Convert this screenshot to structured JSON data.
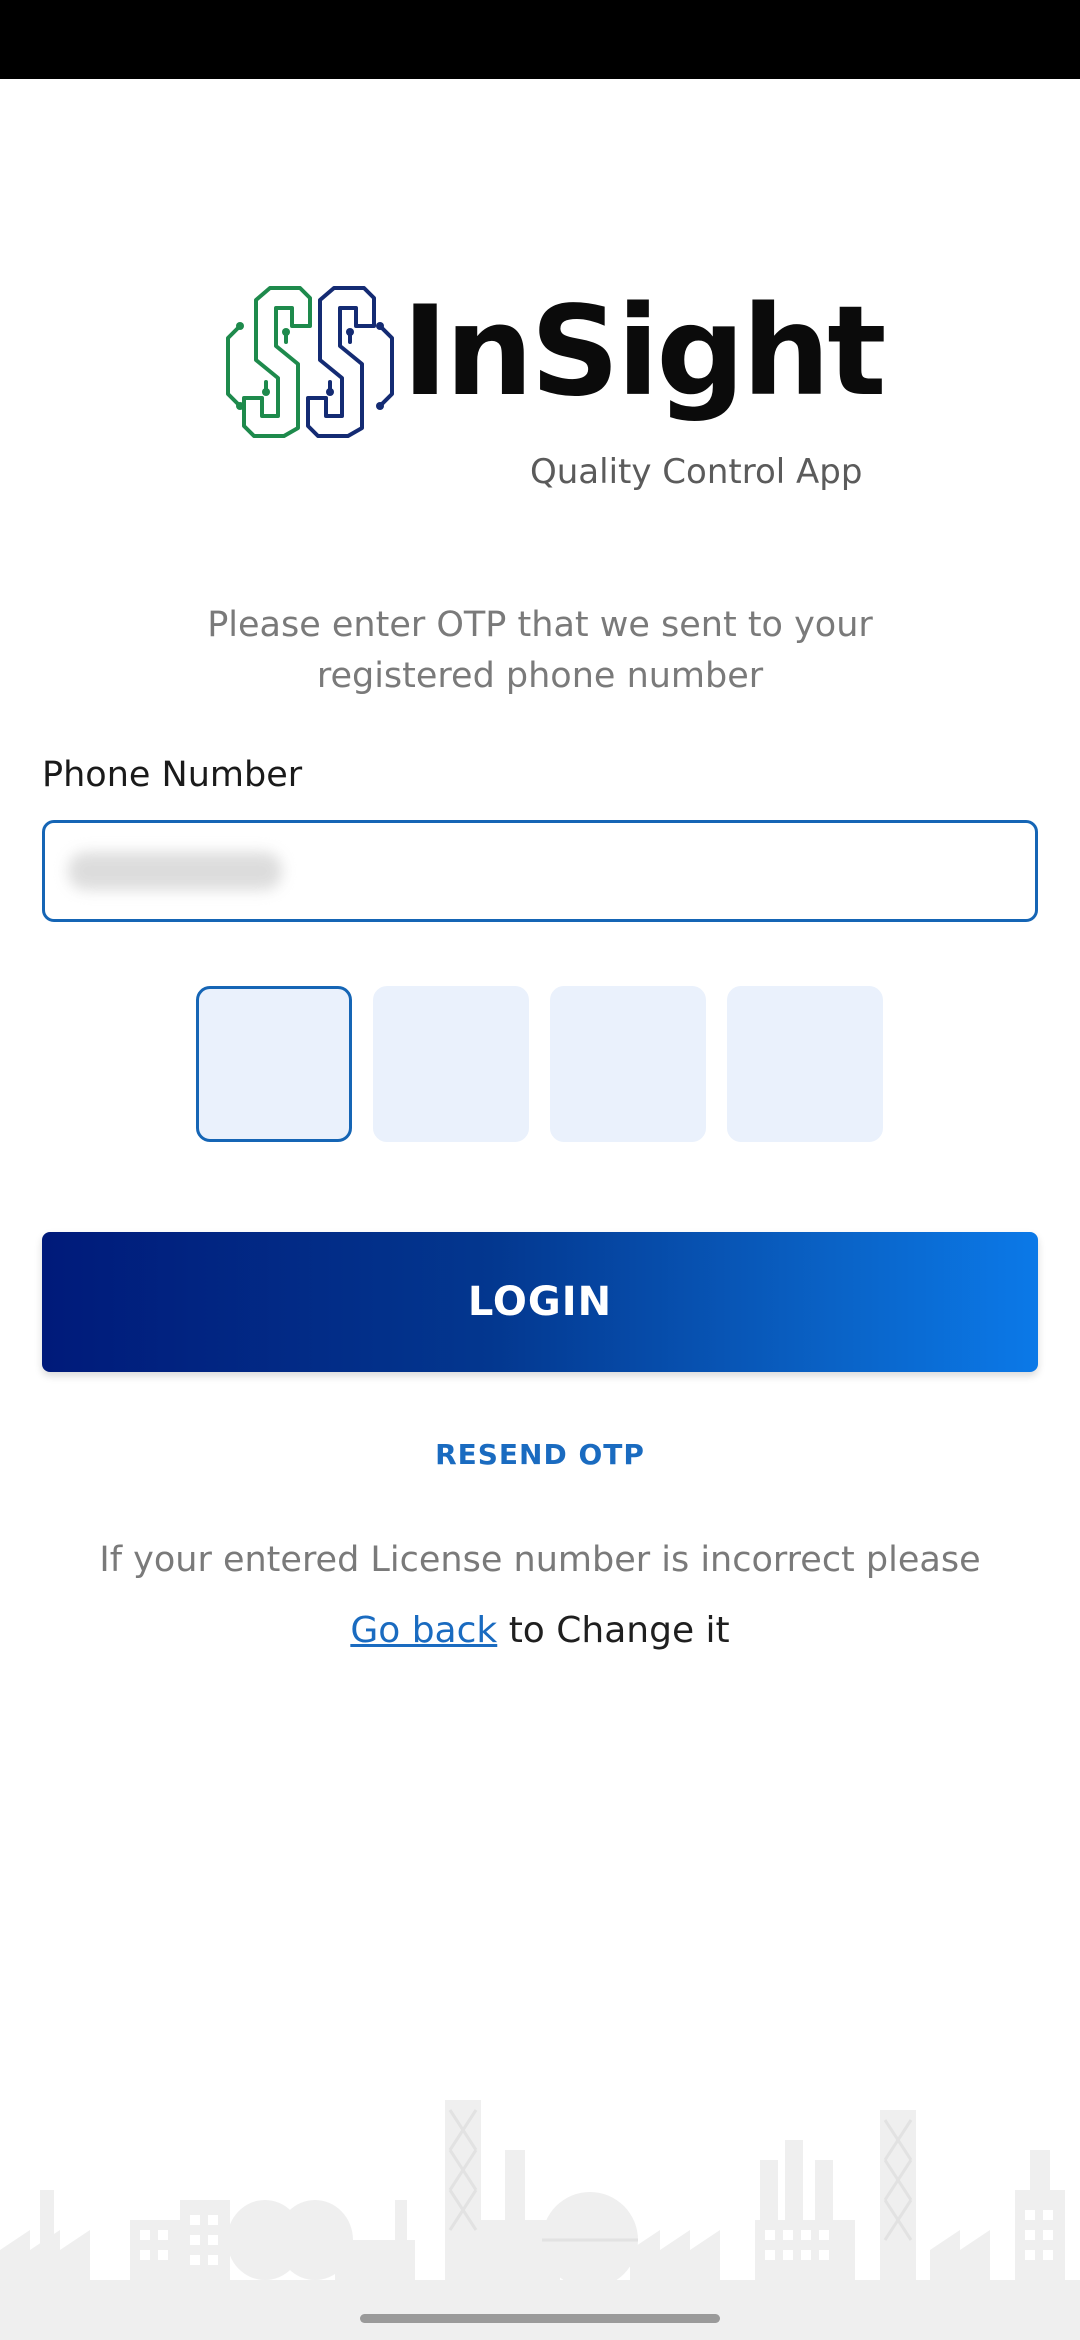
{
  "app": {
    "name": "InSight",
    "tagline": "Quality Control App"
  },
  "otp": {
    "instructions": "Please enter OTP that we sent to your registered phone number",
    "phone_label": "Phone Number",
    "phone_value": "",
    "digit_count": 4,
    "digits": [
      "",
      "",
      "",
      ""
    ]
  },
  "actions": {
    "login_label": "LOGIN",
    "resend_label": "RESEND OTP"
  },
  "hint": {
    "line1": "If your entered License number is incorrect please",
    "go_back_label": "Go back",
    "line2_suffix": " to Change it"
  },
  "colors": {
    "accent": "#1565b5",
    "link": "#1a6bc0",
    "button_gradient_start": "#001a7a",
    "button_gradient_end": "#0b79e8",
    "logo_green": "#1e8a4c",
    "logo_navy": "#142b73",
    "otp_box_bg": "#eaf1fc"
  }
}
